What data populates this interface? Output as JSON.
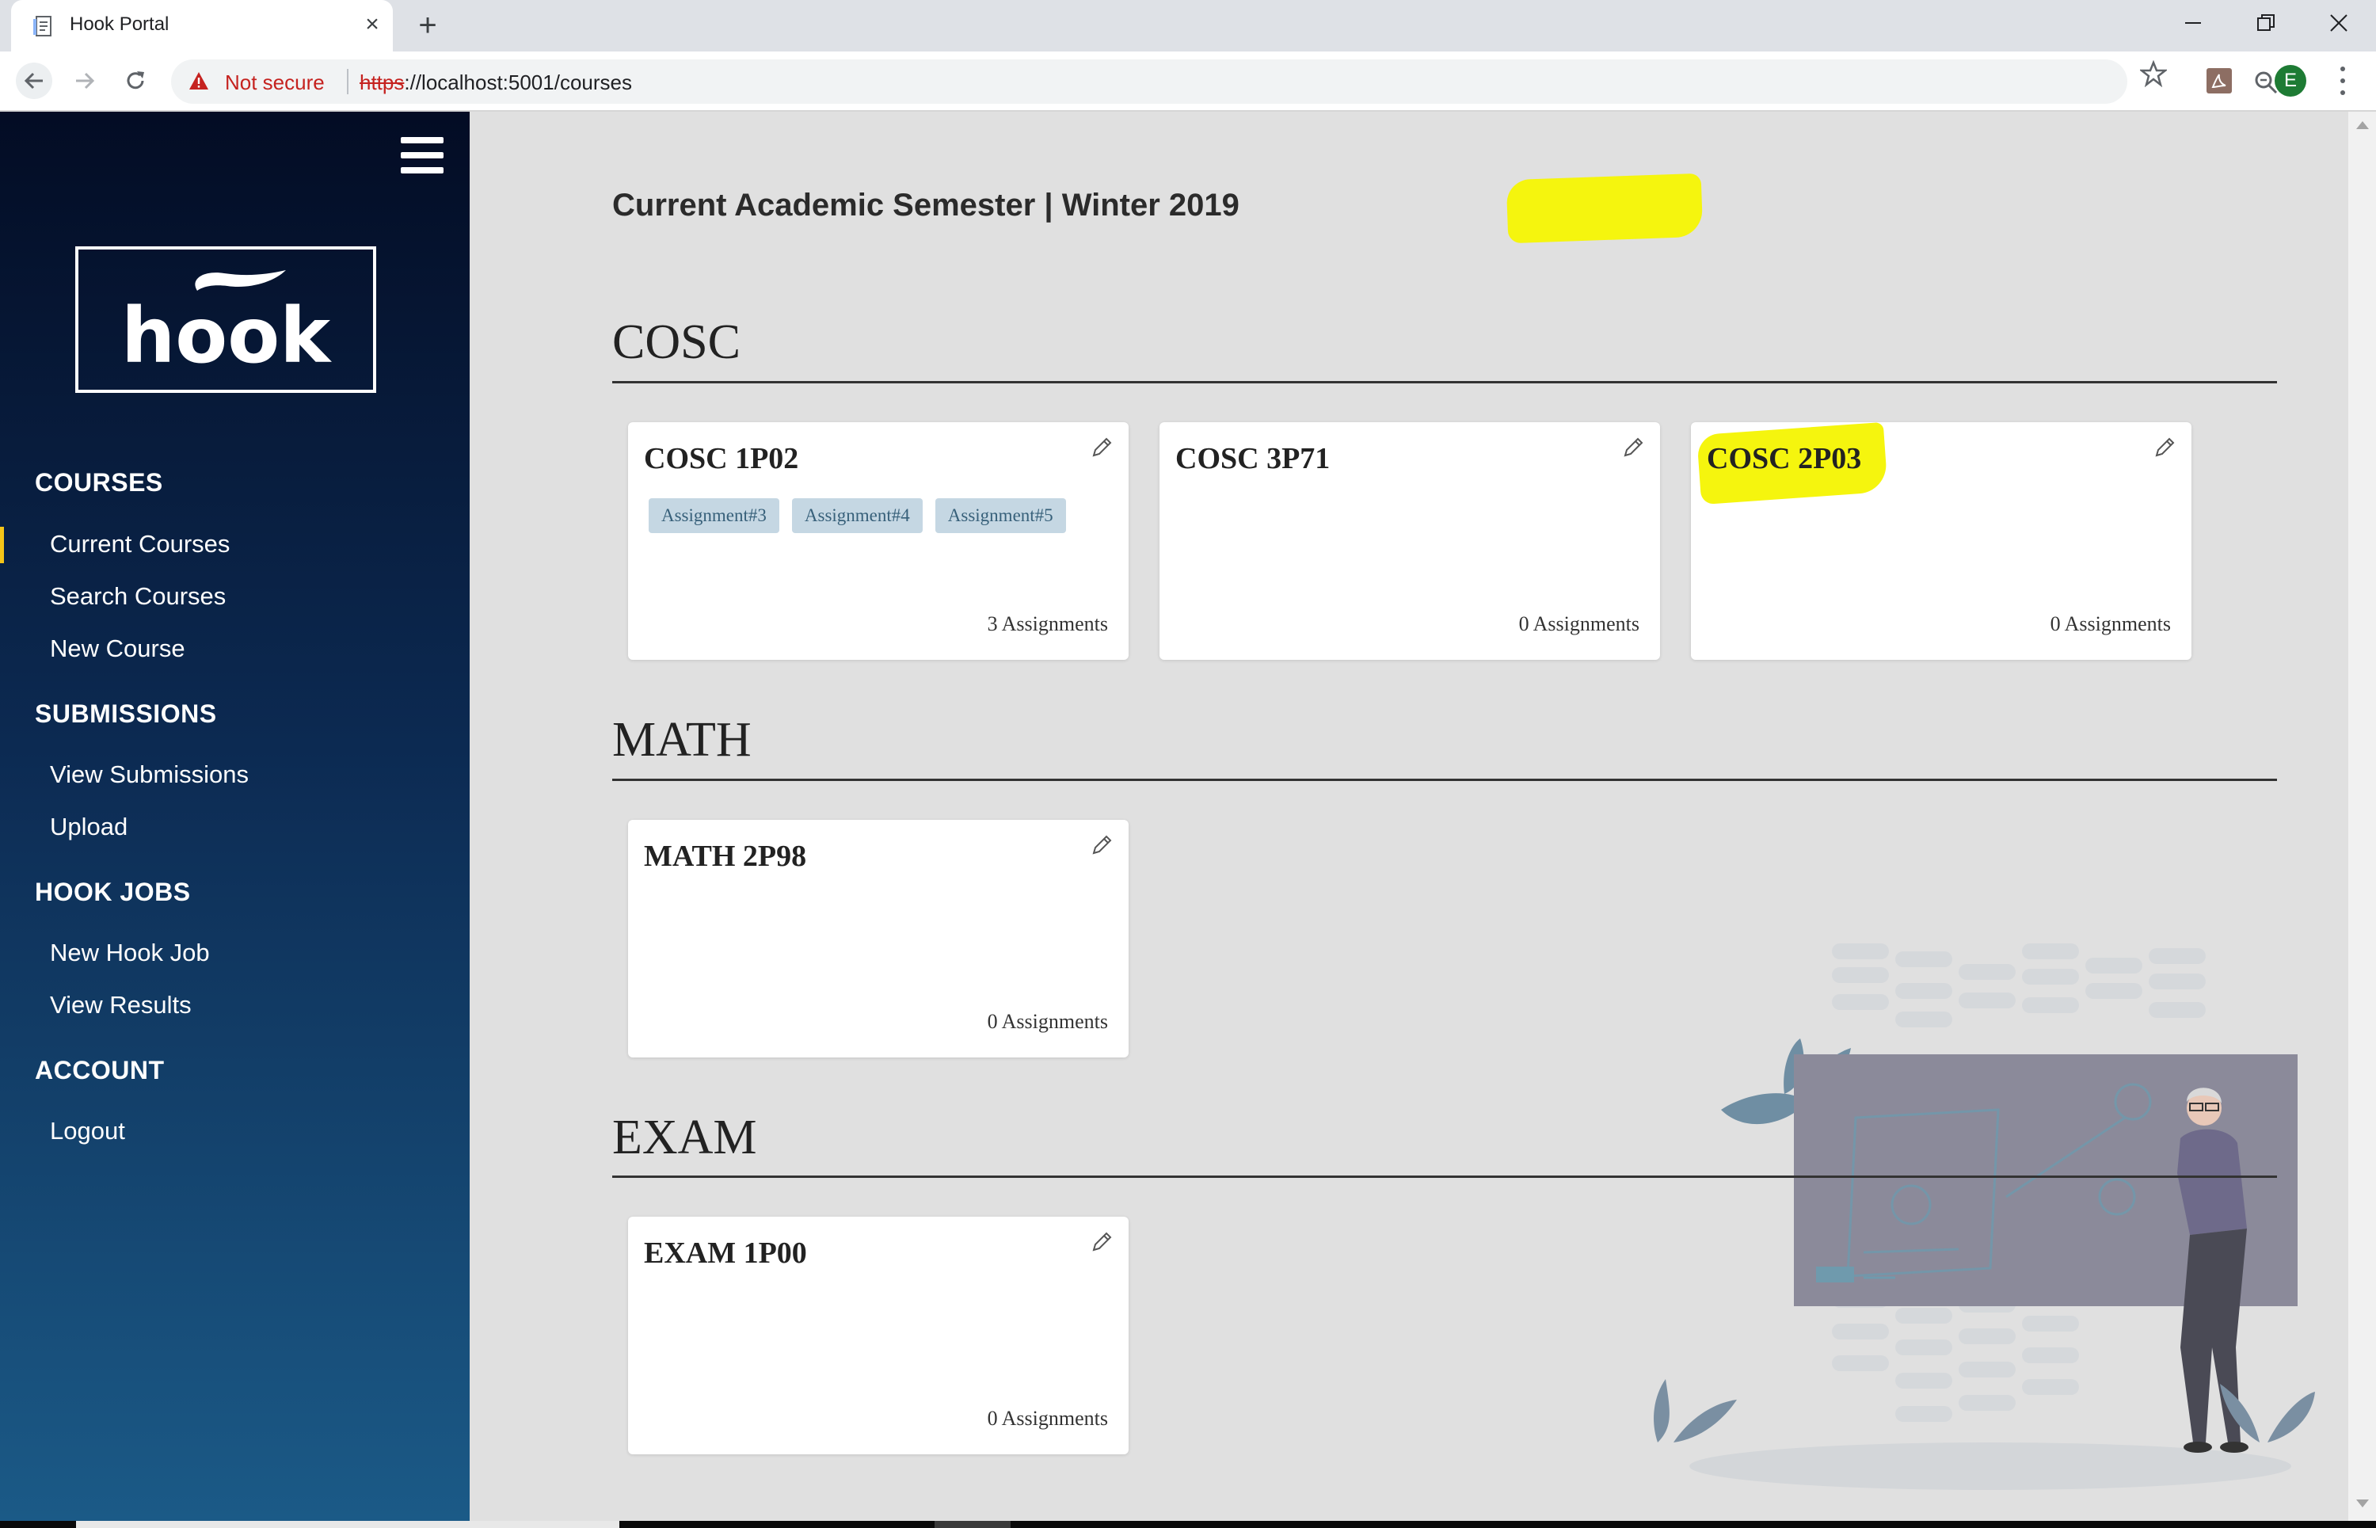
{
  "browser": {
    "tab_title": "Hook Portal",
    "tab_close_icon": "close-icon",
    "new_tab_icon": "plus-icon",
    "security_label": "Not secure",
    "url_scheme": "https",
    "url_rest": "://localhost:5001/courses",
    "avatar_letter": "E"
  },
  "sidebar": {
    "logo_text": "hook",
    "sections": [
      {
        "heading": "COURSES",
        "items": [
          "Current Courses",
          "Search Courses",
          "New Course"
        ]
      },
      {
        "heading": "SUBMISSIONS",
        "items": [
          "View Submissions",
          "Upload"
        ]
      },
      {
        "heading": "HOOK JOBS",
        "items": [
          "New Hook Job",
          "View Results"
        ]
      },
      {
        "heading": "ACCOUNT",
        "items": [
          "Logout"
        ]
      }
    ],
    "active_item": "Current Courses"
  },
  "main": {
    "semester_prefix": "Current Academic Semester | ",
    "semester_name": "Winter 2019",
    "sections": [
      {
        "title": "COSC",
        "courses": [
          {
            "name": "COSC 1P02",
            "tags": [
              "Assignment#3",
              "Assignment#4",
              "Assignment#5"
            ],
            "count": "3 Assignments"
          },
          {
            "name": "COSC 3P71",
            "tags": [],
            "count": "0 Assignments"
          },
          {
            "name": "COSC 2P03",
            "tags": [],
            "count": "0 Assignments",
            "highlighted": true
          }
        ]
      },
      {
        "title": "MATH",
        "courses": [
          {
            "name": "MATH 2P98",
            "tags": [],
            "count": "0 Assignments"
          }
        ]
      },
      {
        "title": "EXAM",
        "courses": [
          {
            "name": "EXAM 1P00",
            "tags": [],
            "count": "0 Assignments"
          }
        ]
      }
    ]
  },
  "colors": {
    "sidebar_top": "#030c24",
    "sidebar_bottom": "#1b5a87",
    "highlight": "#f5f50e",
    "active_marker": "#f5c518",
    "tag_bg": "#c5d7e3",
    "tag_text": "#37607a",
    "not_secure": "#c5221f"
  }
}
